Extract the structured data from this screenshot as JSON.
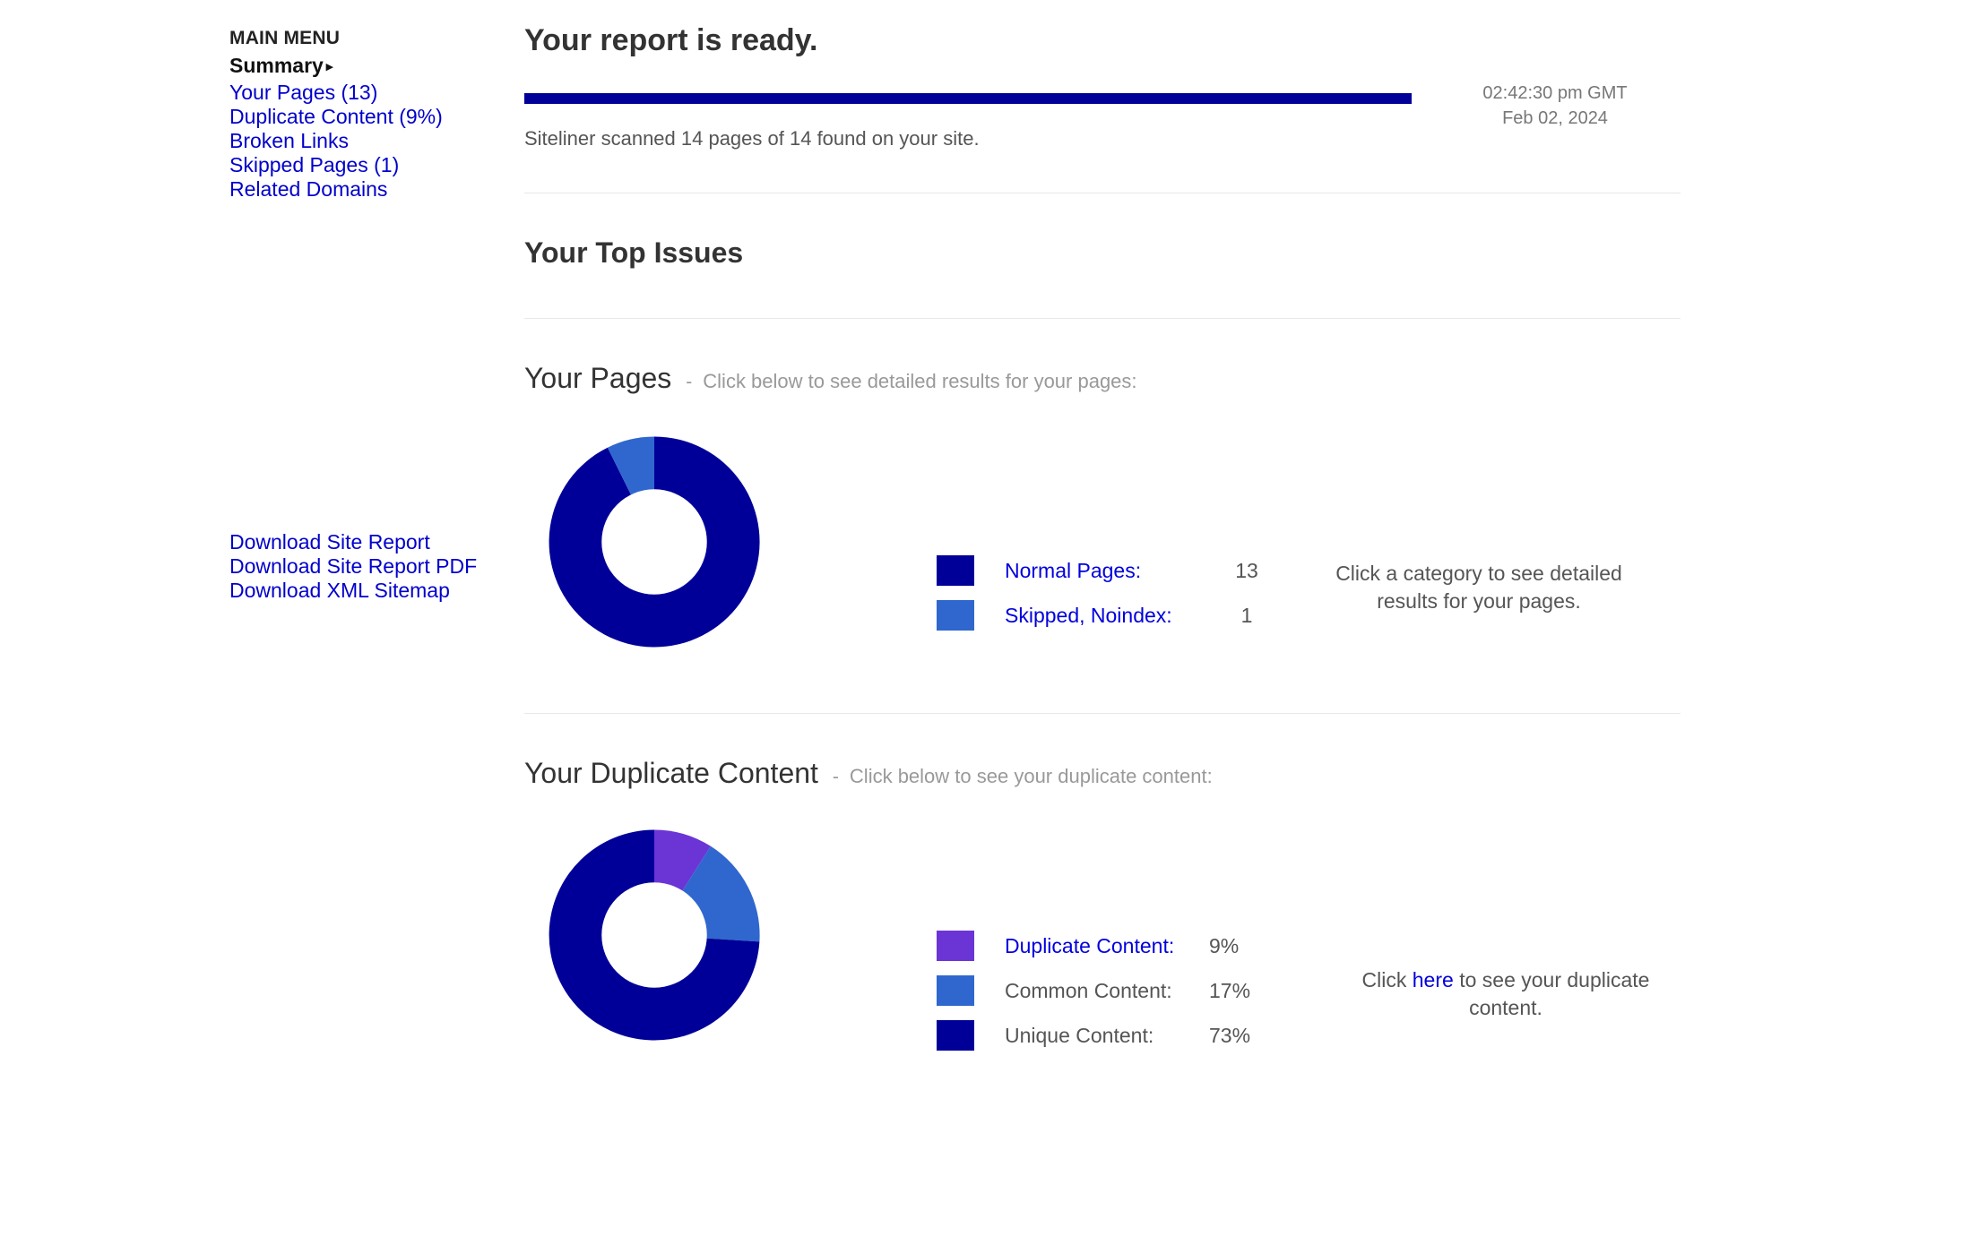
{
  "sidebar": {
    "menu_title": "MAIN MENU",
    "current": "Summary",
    "caret": "▸",
    "items": [
      {
        "label": "Your Pages (13)"
      },
      {
        "label": "Duplicate Content (9%)"
      },
      {
        "label": "Broken Links"
      },
      {
        "label": "Skipped Pages (1)"
      },
      {
        "label": "Related Domains"
      }
    ],
    "downloads": [
      {
        "label": "Download Site Report"
      },
      {
        "label": "Download Site Report PDF"
      },
      {
        "label": "Download XML Sitemap"
      }
    ]
  },
  "header": {
    "title": "Your report is ready.",
    "progress_percent": 100,
    "time": "02:42:30 pm GMT",
    "date": "Feb 02, 2024",
    "scan_status": "Siteliner scanned 14 pages of 14 found on your site."
  },
  "top_issues": {
    "title": "Your Top Issues"
  },
  "pages_section": {
    "title": "Your Pages",
    "dash": "-",
    "subtitle": "Click below to see detailed results for your pages:",
    "hint": "Click a category to see detailed results for your pages."
  },
  "duplicate_section": {
    "title": "Your Duplicate Content",
    "dash": "-",
    "subtitle": "Click below to see your duplicate content:",
    "hint_before": "Click ",
    "hint_link": "here",
    "hint_after": " to see your duplicate content."
  },
  "colors": {
    "navy": "#000099",
    "blue": "#2f67ce",
    "purple": "#6b35d6",
    "link": "#0000cc",
    "progress": "#000099"
  },
  "chart_data": [
    {
      "type": "pie",
      "title": "Your Pages",
      "donut": true,
      "unit": "pages",
      "total": 14,
      "categories": [
        "Normal Pages:",
        "Skipped, Noindex:"
      ],
      "values": [
        13,
        1
      ],
      "value_labels": [
        "13",
        "1"
      ],
      "colors": [
        "#000099",
        "#2f67ce"
      ],
      "legend_position": "right",
      "start_angle": 0
    },
    {
      "type": "pie",
      "title": "Your Duplicate Content",
      "donut": true,
      "unit": "percent",
      "total": 99,
      "categories": [
        "Duplicate Content:",
        "Common Content:",
        "Unique Content:"
      ],
      "values": [
        9,
        17,
        73
      ],
      "value_labels": [
        "9%",
        "17%",
        "73%"
      ],
      "colors": [
        "#6b35d6",
        "#2f67ce",
        "#000099"
      ],
      "legend_position": "right",
      "start_angle": 0
    }
  ]
}
